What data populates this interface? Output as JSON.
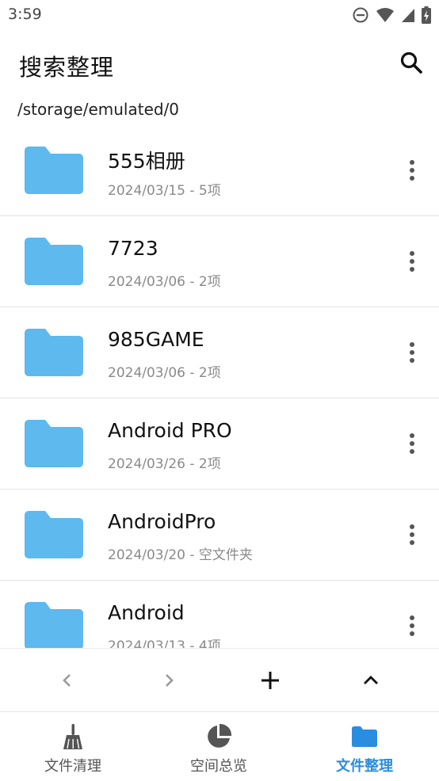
{
  "status_bar": {
    "time": "3:59"
  },
  "app_bar": {
    "title": "搜索整理"
  },
  "path": "/storage/emulated/0",
  "files": [
    {
      "name": "555相册",
      "meta": "2024/03/15 - 5项"
    },
    {
      "name": "7723",
      "meta": "2024/03/06 - 2项"
    },
    {
      "name": "985GAME",
      "meta": "2024/03/06 - 2项"
    },
    {
      "name": "Android PRO",
      "meta": "2024/03/26 - 2项"
    },
    {
      "name": "AndroidPro",
      "meta": "2024/03/20 - 空文件夹"
    },
    {
      "name": "Android",
      "meta": "2024/03/13 - 4项"
    }
  ],
  "bottom_nav": [
    {
      "label": "文件清理",
      "icon": "broom-icon"
    },
    {
      "label": "空间总览",
      "icon": "pie-chart-icon"
    },
    {
      "label": "文件整理",
      "icon": "folder-icon"
    }
  ],
  "colors": {
    "accent": "#2a8de0",
    "folder": "#5db9ee"
  }
}
